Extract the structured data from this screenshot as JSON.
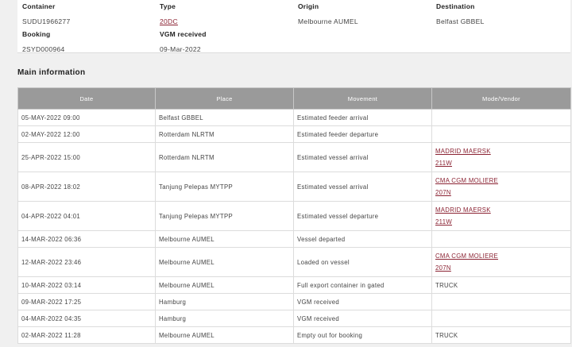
{
  "summary": {
    "container_label": "Container",
    "container_value": "SUDU1966277",
    "type_label": "Type",
    "type_value": "20DC",
    "origin_label": "Origin",
    "origin_value": "Melbourne AUMEL",
    "destination_label": "Destination",
    "destination_value": "Belfast GBBEL",
    "booking_label": "Booking",
    "booking_value": "2SYD000964",
    "vgm_label": "VGM received",
    "vgm_value": "09-Mar-2022"
  },
  "main": {
    "title": "Main information",
    "headers": [
      "Date",
      "Place",
      "Movement",
      "Mode/Vendor"
    ],
    "rows": [
      {
        "date": "05-MAY-2022 09:00",
        "place": "Belfast GBBEL",
        "movement": "Estimated feeder arrival",
        "mode": "",
        "voyage": ""
      },
      {
        "date": "02-MAY-2022 12:00",
        "place": "Rotterdam NLRTM",
        "movement": "Estimated feeder departure",
        "mode": "",
        "voyage": ""
      },
      {
        "date": "25-APR-2022 15:00",
        "place": "Rotterdam NLRTM",
        "movement": "Estimated vessel arrival",
        "mode": "MADRID MAERSK",
        "voyage": "211W"
      },
      {
        "date": "08-APR-2022 18:02",
        "place": "Tanjung Pelepas MYTPP",
        "movement": "Estimated vessel arrival",
        "mode": "CMA CGM MOLIERE",
        "voyage": "207N"
      },
      {
        "date": "04-APR-2022 04:01",
        "place": "Tanjung Pelepas MYTPP",
        "movement": "Estimated vessel departure",
        "mode": "MADRID MAERSK",
        "voyage": "211W"
      },
      {
        "date": "14-MAR-2022 06:36",
        "place": "Melbourne AUMEL",
        "movement": "Vessel departed",
        "mode": "",
        "voyage": ""
      },
      {
        "date": "12-MAR-2022 23:46",
        "place": "Melbourne AUMEL",
        "movement": "Loaded on vessel",
        "mode": "CMA CGM MOLIERE",
        "voyage": "207N"
      },
      {
        "date": "10-MAR-2022 03:14",
        "place": "Melbourne AUMEL",
        "movement": "Full export container in gated",
        "mode": "TRUCK",
        "voyage": ""
      },
      {
        "date": "09-MAR-2022 17:25",
        "place": "Hamburg",
        "movement": "VGM received",
        "mode": "",
        "voyage": ""
      },
      {
        "date": "04-MAR-2022 04:35",
        "place": "Hamburg",
        "movement": "VGM received",
        "mode": "",
        "voyage": ""
      },
      {
        "date": "02-MAR-2022 11:28",
        "place": "Melbourne AUMEL",
        "movement": "Empty out for booking",
        "mode": "TRUCK",
        "voyage": ""
      }
    ]
  },
  "colors": {
    "link": "#8b2333",
    "header_bg": "#9a9a9a",
    "page_bg": "#f0f0f0"
  }
}
